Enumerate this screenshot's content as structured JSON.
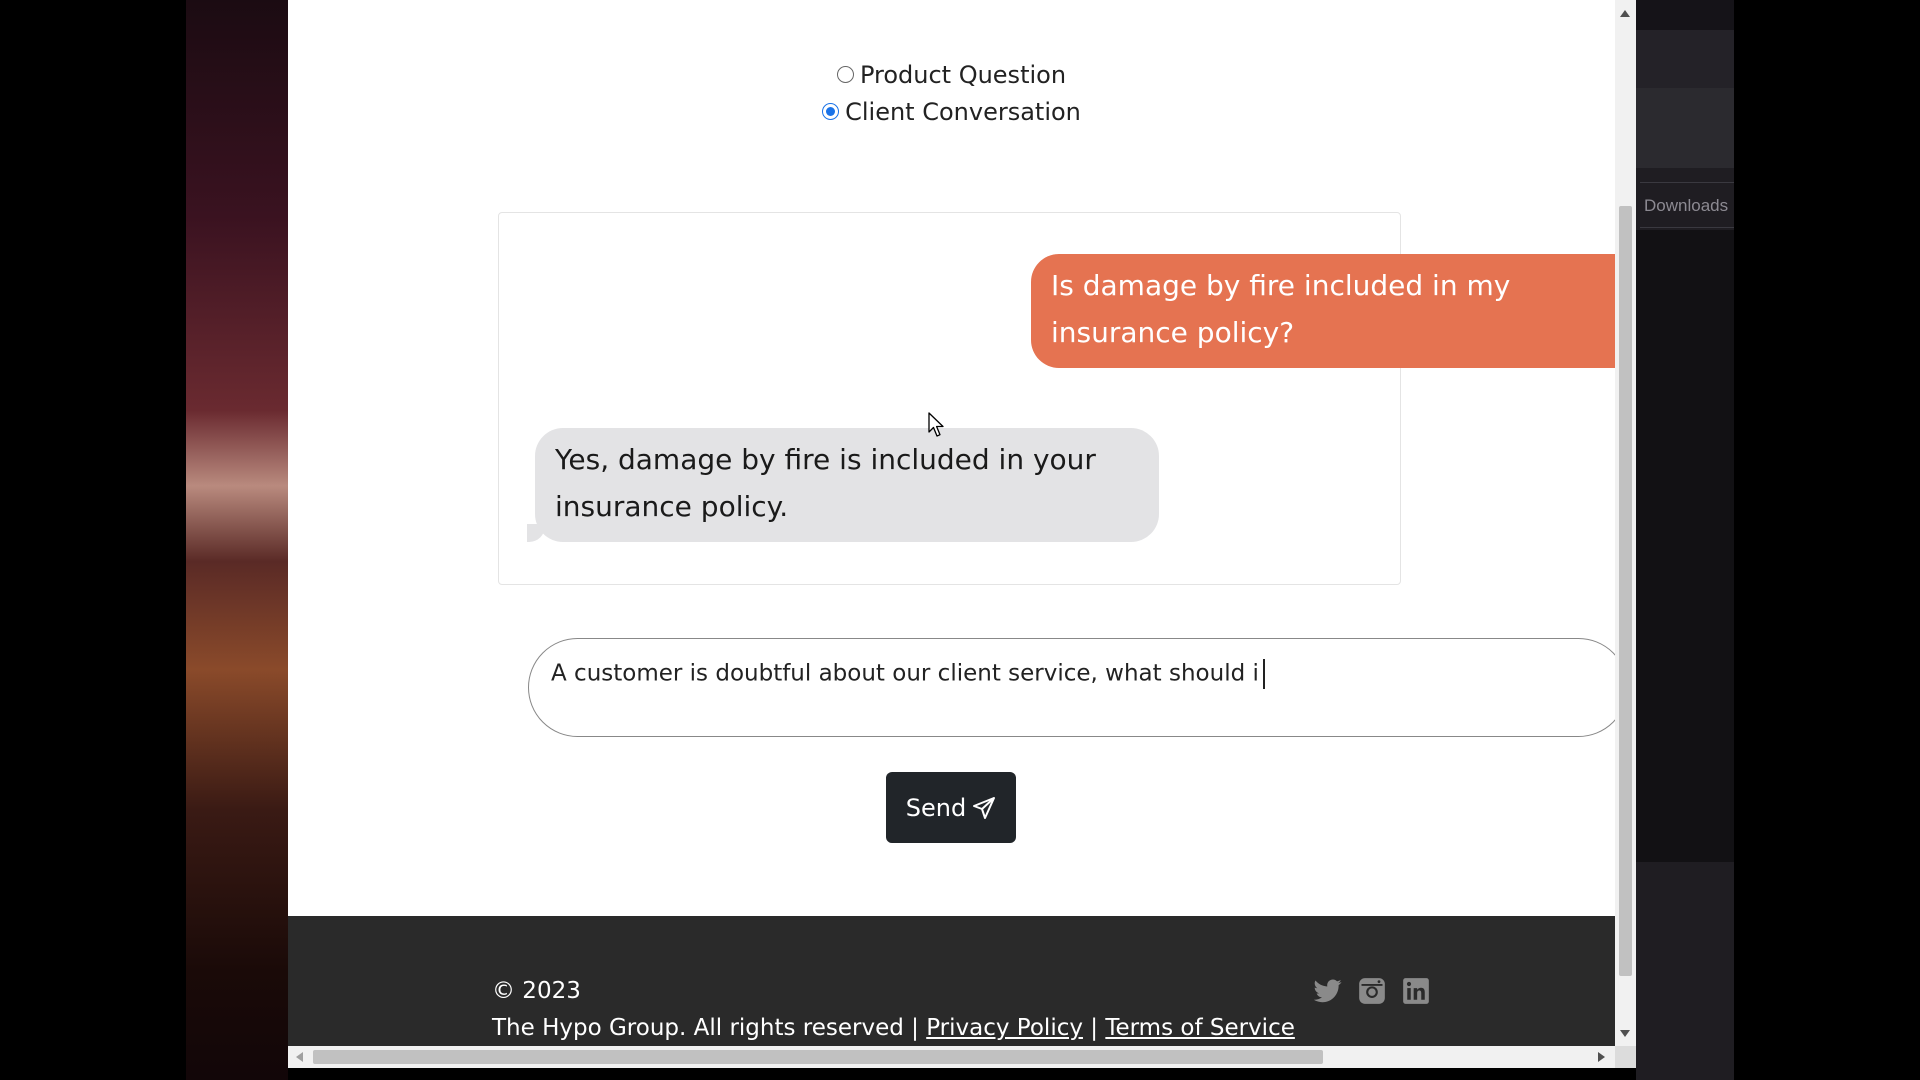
{
  "conversation_mode": {
    "options": [
      {
        "label": "Product Question",
        "checked": false
      },
      {
        "label": "Client Conversation",
        "checked": true
      }
    ]
  },
  "chat": {
    "messages": [
      {
        "role": "user",
        "text": "Is damage by fire included in my insurance policy?"
      },
      {
        "role": "assistant",
        "text": "Yes, damage by fire is included in your insurance policy."
      }
    ]
  },
  "composer": {
    "value": "A customer is doubtful about our client service, what should i",
    "send_label": "Send",
    "send_icon": "paper-plane-icon"
  },
  "footer": {
    "copyright": "© 2023",
    "rights_text": "The Hypo Group. All rights reserved |",
    "privacy_link": "Privacy Policy",
    "separator": "|",
    "terms_link": "Terms of Service",
    "social_icons": [
      "twitter-icon",
      "instagram-icon",
      "linkedin-icon"
    ]
  },
  "side_panel": {
    "downloads_label": "Downloads"
  },
  "colors": {
    "user_bubble": "#e57351",
    "assistant_bubble": "#e3e3e5",
    "send_button": "#212529",
    "footer_bg": "#2a2a2a",
    "radio_accent": "#1a73e8"
  }
}
